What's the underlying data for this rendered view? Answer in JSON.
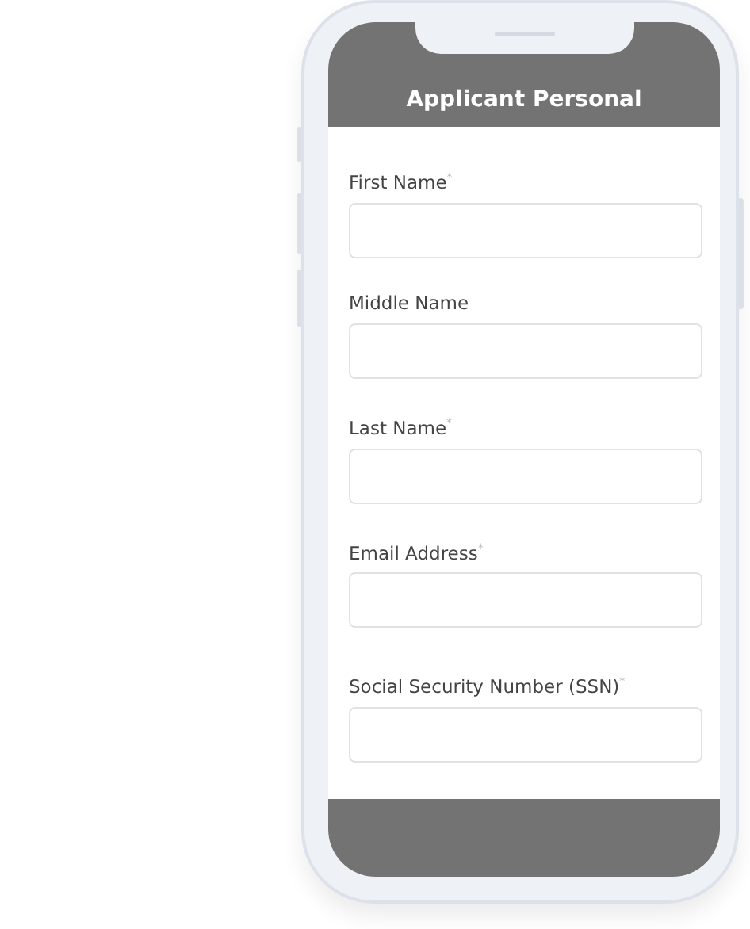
{
  "header": {
    "title": "Applicant Personal"
  },
  "fields": [
    {
      "label": "First Name$^{*}$"
    },
    {
      "label": "Middle Name"
    },
    {
      "label": "Last Name$^{*}$"
    },
    {
      "label": "Email Address$^{*}$"
    },
    {
      "label": "Social Security Number (SSN)$^{*}$"
    }
  ]
}
